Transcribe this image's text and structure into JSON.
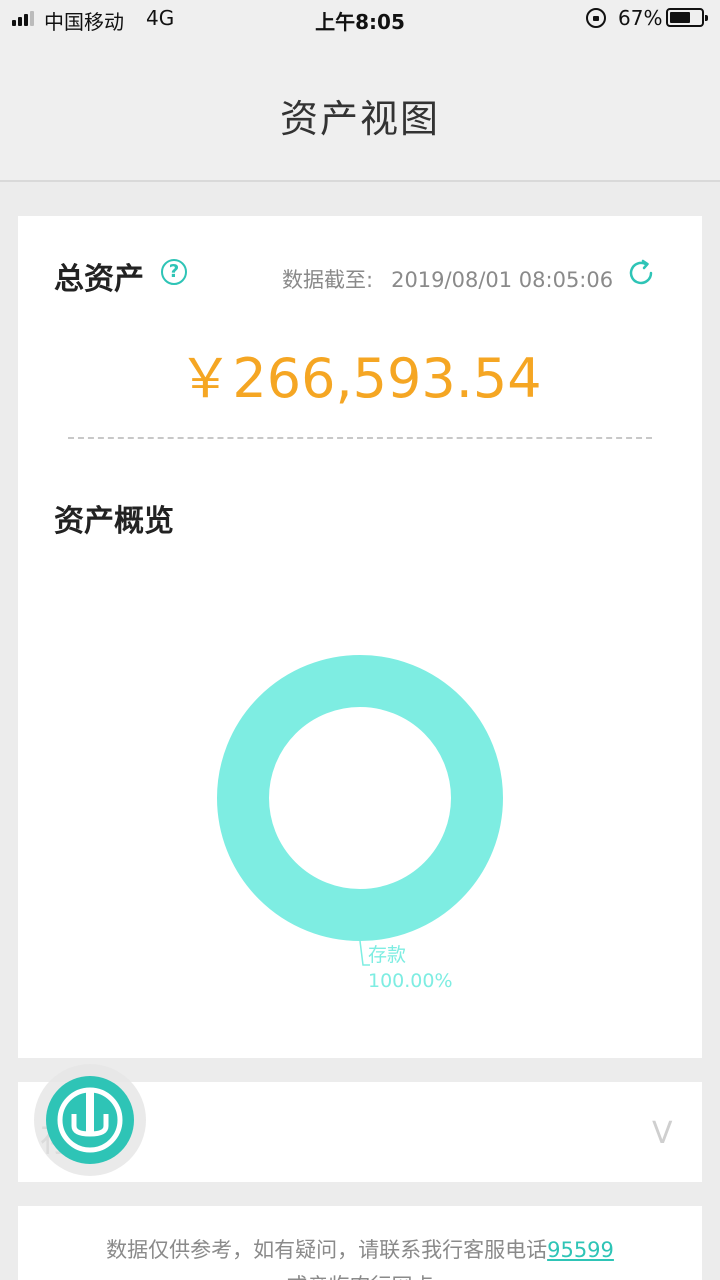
{
  "status_bar": {
    "carrier": "中国移动",
    "network": "4G",
    "time": "上午8:05",
    "battery": "67%",
    "battery_level": 0.67
  },
  "nav": {
    "title": "资产视图"
  },
  "summary": {
    "total_label": "总资产",
    "help_icon": "?",
    "as_of_label": "数据截至:",
    "as_of_value": "2019/08/01 08:05:06",
    "amount": "￥266,593.54",
    "overview_label": "资产概览"
  },
  "chart_data": {
    "type": "pie",
    "categories": [
      "存款"
    ],
    "values": [
      100.0
    ],
    "labels": [
      "100.00%"
    ],
    "colors": [
      "#7eede2"
    ]
  },
  "deposit_section": {
    "label": "存款",
    "chevron": "V"
  },
  "footer": {
    "text": "数据仅供参考，如有疑问，请联系我行客服电话",
    "phone": "95599",
    "text2": "或亲临农行网点"
  },
  "colors": {
    "accent": "#2ec4b6",
    "amount": "#f5a623",
    "donut": "#7eede2"
  }
}
